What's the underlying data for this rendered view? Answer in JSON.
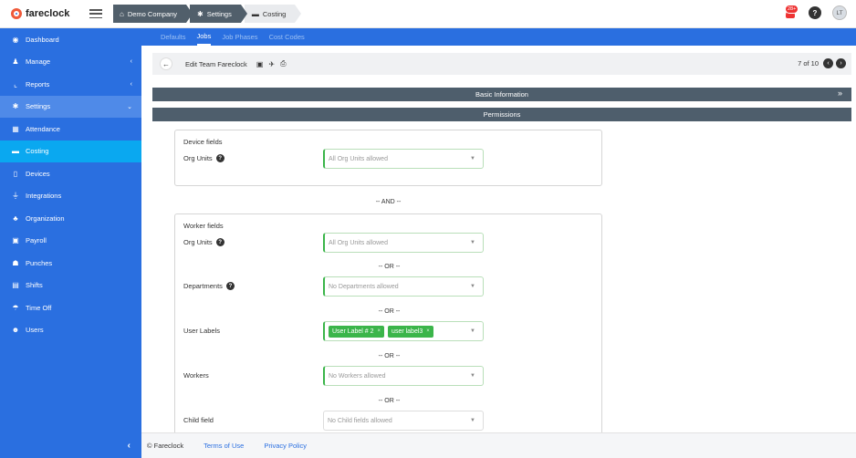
{
  "app": {
    "logo_text": "fareclock",
    "notification_count": "28+",
    "help_label": "?",
    "avatar_initials": "LT"
  },
  "breadcrumb": [
    {
      "label": "Demo Company",
      "icon": "home-icon"
    },
    {
      "label": "Settings",
      "icon": "gear-icon"
    },
    {
      "label": "Costing",
      "icon": "costing-icon"
    }
  ],
  "sidebar": {
    "items": [
      {
        "label": "Dashboard",
        "icon": "dashboard-icon"
      },
      {
        "label": "Manage",
        "icon": "manage-icon"
      },
      {
        "label": "Reports",
        "icon": "reports-icon"
      },
      {
        "label": "Settings",
        "icon": "gear-icon"
      },
      {
        "label": "Attendance",
        "icon": "attendance-icon"
      },
      {
        "label": "Costing",
        "icon": "costing-icon"
      },
      {
        "label": "Devices",
        "icon": "devices-icon"
      },
      {
        "label": "Integrations",
        "icon": "integrations-icon"
      },
      {
        "label": "Organization",
        "icon": "organization-icon"
      },
      {
        "label": "Payroll",
        "icon": "payroll-icon"
      },
      {
        "label": "Punches",
        "icon": "punches-icon"
      },
      {
        "label": "Shifts",
        "icon": "shifts-icon"
      },
      {
        "label": "Time Off",
        "icon": "timeoff-icon"
      },
      {
        "label": "Users",
        "icon": "users-icon"
      }
    ],
    "collapse_label": "‹"
  },
  "tabs": [
    {
      "label": "Defaults"
    },
    {
      "label": "Jobs"
    },
    {
      "label": "Job Phases"
    },
    {
      "label": "Cost Codes"
    }
  ],
  "toolbar": {
    "title": "Edit Team Fareclock",
    "pager_text": "7 of 10"
  },
  "sections": {
    "basic": "Basic Information",
    "permissions": "Permissions"
  },
  "device_fields": {
    "title": "Device fields",
    "org_units_label": "Org Units",
    "org_units_placeholder": "All Org Units allowed"
  },
  "and_separator": "-- AND --",
  "worker_fields": {
    "title": "Worker fields",
    "org_units_label": "Org Units",
    "org_units_placeholder": "All Org Units allowed",
    "departments_label": "Departments",
    "departments_placeholder": "No Departments allowed",
    "user_labels_label": "User Labels",
    "user_label_tags": [
      "User Label # 2",
      "user label3"
    ],
    "workers_label": "Workers",
    "workers_placeholder": "No Workers allowed",
    "child_field_label": "Child field",
    "child_field_placeholder": "No Child fields allowed",
    "or_separator": "-- OR --"
  },
  "footer": {
    "copyright": "© Fareclock",
    "terms": "Terms of Use",
    "privacy": "Privacy Policy"
  },
  "colors": {
    "primary": "#2a6fe0",
    "active_item": "#0aa8f0",
    "section_bar": "#4e5e6c",
    "tag_green": "#3bb54a",
    "logo_red": "#ef5a3a"
  }
}
